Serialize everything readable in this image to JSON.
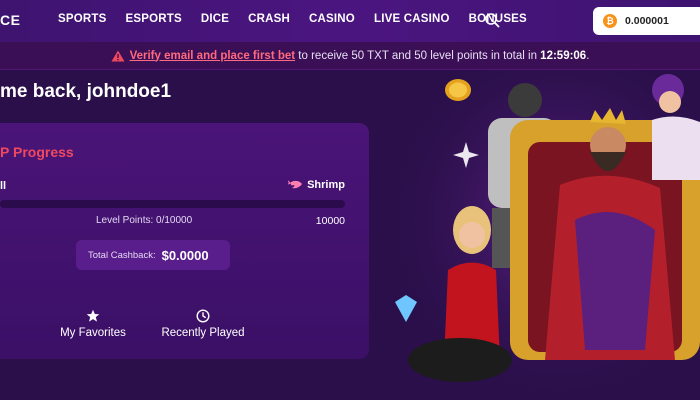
{
  "header": {
    "logo": "CE",
    "nav": [
      "SPORTS",
      "ESPORTS",
      "DICE",
      "CRASH",
      "CASINO",
      "LIVE CASINO",
      "BONUSES"
    ],
    "wallet": {
      "currency_icon": "bitcoin-icon",
      "amount": "0.000001"
    }
  },
  "alert": {
    "link": "Verify email and place first bet",
    "text": " to receive 50 TXT and 50 level points in total in ",
    "time": "12:59:06",
    "end": "."
  },
  "welcome": "me back, johndoe1",
  "vip": {
    "title": "P Progress",
    "rank_current": "ll",
    "rank_next": "Shrimp",
    "progress": 0,
    "level_points": "Level Points: 0/10000",
    "level_max": "10000",
    "cashback_label": "Total Cashback:",
    "cashback_value": "$0.0000"
  },
  "quick_links": [
    {
      "label": "My Favorites",
      "icon": "star-icon"
    },
    {
      "label": "Recently Played",
      "icon": "clock-icon"
    }
  ],
  "colors": {
    "accent": "#f0495f",
    "background": "#2a0f4a",
    "topbar": "#4b1580"
  }
}
